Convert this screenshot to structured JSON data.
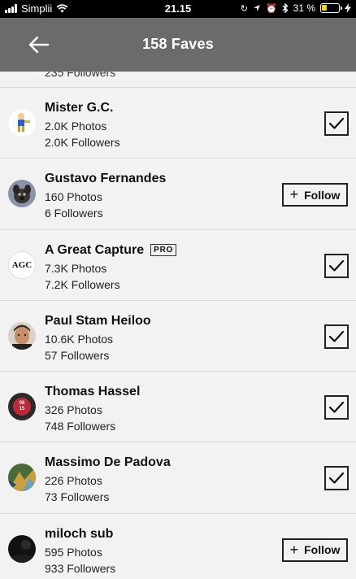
{
  "status_bar": {
    "carrier": "Simplii",
    "time": "21.15",
    "battery": "31 %",
    "battery_level": 0.31,
    "battery_color": "#ffd60a",
    "icons": [
      "signal-icon",
      "wifi-icon",
      "orientation-lock-icon",
      "location-icon",
      "alarm-icon",
      "bluetooth-icon",
      "battery-icon",
      "charging-icon"
    ]
  },
  "header": {
    "title": "158 Faves",
    "back_icon": "arrow-left-icon",
    "background": "#6b6b6b"
  },
  "partial_row": {
    "followers": "235 Followers"
  },
  "users": [
    {
      "name": "Mister G.C.",
      "pro": false,
      "photos": "2.0K Photos",
      "followers": "2.0K Followers",
      "state": "following",
      "avatar": "cartoon-figure"
    },
    {
      "name": "Gustavo Fernandes",
      "pro": false,
      "photos": "160 Photos",
      "followers": "6 Followers",
      "state": "follow",
      "follow_label": "Follow",
      "avatar": "dog"
    },
    {
      "name": "A Great Capture",
      "pro": true,
      "pro_label": "PRO",
      "photos": "7.3K Photos",
      "followers": "7.2K Followers",
      "state": "following",
      "avatar": "agc-logo",
      "avatar_text": "AGC"
    },
    {
      "name": "Paul Stam Heiloo",
      "pro": false,
      "photos": "10.6K Photos",
      "followers": "57 Followers",
      "state": "following",
      "avatar": "portrait"
    },
    {
      "name": "Thomas Hassel",
      "pro": false,
      "photos": "326 Photos",
      "followers": "748 Followers",
      "state": "following",
      "avatar": "calendar-badge",
      "avatar_text_top": "08",
      "avatar_text_bottom": "15"
    },
    {
      "name": "Massimo De Padova",
      "pro": false,
      "photos": "226 Photos",
      "followers": "73 Followers",
      "state": "following",
      "avatar": "abstract"
    },
    {
      "name": "miloch sub",
      "pro": false,
      "photos": "595 Photos",
      "followers": "933 Followers",
      "state": "follow",
      "follow_label": "Follow",
      "avatar": "dark-photo"
    }
  ]
}
